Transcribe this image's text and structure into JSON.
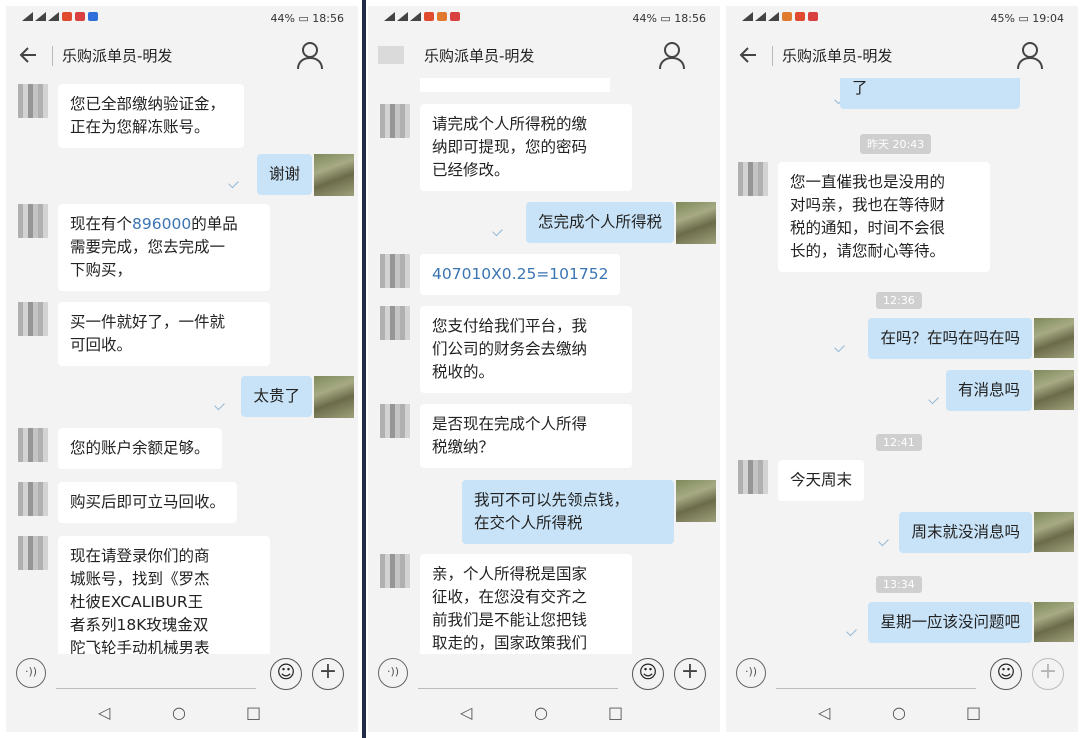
{
  "screens": [
    {
      "status": {
        "left_label": "",
        "battery": "44%",
        "time": "18:56"
      },
      "title": "乐购派单员-明发",
      "messages": [
        {
          "side": "left",
          "lines": [
            "您已全部缴纳验证金，",
            "正在为您解冻账号。"
          ]
        },
        {
          "side": "right",
          "text": "谢谢"
        },
        {
          "side": "left",
          "lines_rich": [
            "现在有个",
            "896000",
            "的单品"
          ],
          "lines": [
            "需要完成，您去完成一",
            "下购买，"
          ]
        },
        {
          "side": "left",
          "lines": [
            "买一件就好了，一件就",
            "可回收。"
          ]
        },
        {
          "side": "right",
          "text": "太贵了"
        },
        {
          "side": "left",
          "lines": [
            "您的账户余额足够。"
          ]
        },
        {
          "side": "left",
          "lines": [
            "购买后即可立马回收。"
          ]
        },
        {
          "side": "left",
          "lines": [
            "现在请登录你们的商",
            "城账号，找到《罗杰",
            "杜彼EXCALIBUR王",
            "者系列18K玫瑰金双",
            "陀飞轮手动机械男表"
          ]
        }
      ]
    },
    {
      "status": {
        "battery": "44%",
        "time": "18:56"
      },
      "title": "乐购派单员-明发",
      "messages": [
        {
          "side": "left",
          "lines": [
            "请完成个人所得税的缴",
            "纳即可提现，您的密码",
            "已经修改。"
          ]
        },
        {
          "side": "right",
          "text": "怎完成个人所得税"
        },
        {
          "side": "left",
          "text": "407010X0.25=101752"
        },
        {
          "side": "left",
          "lines": [
            "您支付给我们平台，我",
            "们公司的财务会去缴纳",
            "税收的。"
          ]
        },
        {
          "side": "left",
          "lines": [
            "是否现在完成个人所得",
            "税缴纳？"
          ]
        },
        {
          "side": "right",
          "lines": [
            "我可不可以先领点钱，",
            "在交个人所得税"
          ]
        },
        {
          "side": "left",
          "lines": [
            "亲，个人所得税是国家",
            "征收，在您没有交齐之",
            "前我们是不能让您把钱",
            "取走的，国家政策我们"
          ]
        }
      ]
    },
    {
      "status": {
        "battery": "45%",
        "time": "19:04"
      },
      "title": "乐购派单员-明发",
      "messages": [
        {
          "side": "right",
          "text": "了"
        },
        {
          "side": "time",
          "text": "昨天 20:43"
        },
        {
          "side": "left",
          "lines": [
            "您一直催我也是没用的",
            "对吗亲，我也在等待财",
            "税的通知，时间不会很",
            "长的，请您耐心等待。"
          ]
        },
        {
          "side": "time",
          "text": "12:36"
        },
        {
          "side": "right",
          "text": "在吗？在吗在吗在吗"
        },
        {
          "side": "right",
          "text": "有消息吗"
        },
        {
          "side": "time",
          "text": "12:41"
        },
        {
          "side": "left",
          "text": "今天周末"
        },
        {
          "side": "right",
          "text": "周末就没消息吗"
        },
        {
          "side": "time",
          "text": "13:34"
        },
        {
          "side": "right",
          "text": "星期一应该没问题吧"
        }
      ]
    }
  ],
  "icons": {
    "back": "back-arrow-icon",
    "contact": "person-icon",
    "voice": "voice-icon",
    "emoji": "emoji-icon",
    "plus": "plus-icon",
    "nav": [
      "◁",
      "○",
      "□"
    ]
  },
  "colors": {
    "bubble_right": "#c8e3f7",
    "bubble_left": "#ffffff",
    "background": "#f3f3f3",
    "link_number": "#3a74b3"
  }
}
